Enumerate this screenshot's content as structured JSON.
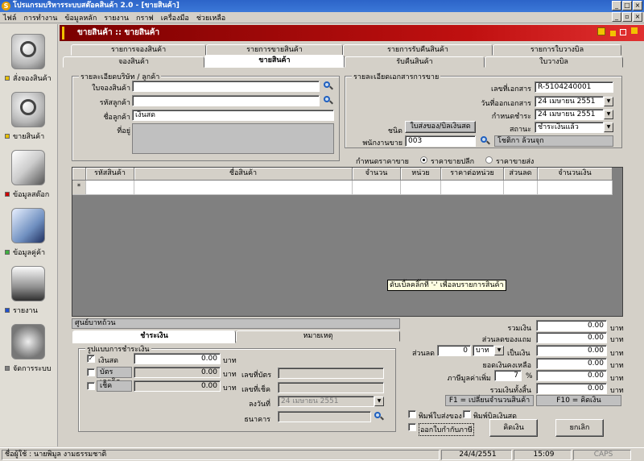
{
  "window": {
    "title": "โปรแกรมบริหารระบบสต๊อคสินค้า 2.0   - [ขายสินค้า]",
    "app_icon": "S"
  },
  "menu": [
    "ไฟล์",
    "การทำงาน",
    "ข้อมูลหลัก",
    "รายงาน",
    "กราฟ",
    "เครื่องมือ",
    "ช่วยเหลือ"
  ],
  "sidebar": [
    {
      "label": "สั่งจองสินค้า",
      "icon": "search-icon",
      "color": "#e8c000"
    },
    {
      "label": "ขายสินค้า",
      "icon": "search-icon",
      "color": "#e8c000"
    },
    {
      "label": "ข้อมูลสต๊อก",
      "icon": "documents-icon",
      "color": "#d00000"
    },
    {
      "label": "ข้อมูลคู่ค้า",
      "icon": "contacts-icon",
      "color": "#40b040"
    },
    {
      "label": "รายงาน",
      "icon": "printer-icon",
      "color": "#2050d0"
    },
    {
      "label": "จัดการระบบ",
      "icon": "gears-icon",
      "color": "#808080"
    }
  ],
  "form_header": {
    "title": "ขายสินค้า :: ขายสินค้า"
  },
  "tabs_top": [
    "รายการจองสินค้า",
    "รายการขายสินค้า",
    "รายการรับคืนสินค้า",
    "รายการใบวางบิล"
  ],
  "tabs_bottom": [
    "จองสินค้า",
    "ขายสินค้า",
    "รับคืนสินค้า",
    "ใบวางบิล"
  ],
  "customer": {
    "group_title": "รายละเอียดบริษัท / ลูกค้า",
    "booking_no_label": "ใบจองสินค้า",
    "booking_no": "",
    "customer_code_label": "รหัสลูกค้า",
    "customer_code": "",
    "customer_name_label": "ชื่อลูกค้า",
    "customer_name": "เงินสด",
    "address_label": "ที่อยู่",
    "address": ""
  },
  "document": {
    "group_title": "รายละเอียดเอกสารการขาย",
    "doc_no_label": "เลขที่เอกสาร",
    "doc_no": "R-5104240001",
    "issue_date_label": "วันที่ออกเอกสาร",
    "issue_date": "24   เมษายน   2551",
    "due_date_label": "กำหนดชำระ",
    "due_date": "24   เมษายน   2551",
    "status_label": "สถานะ",
    "status": "ชำระเงินแล้ว",
    "type_label": "ชนิด",
    "type_button": "ใบส่งของ/บิลเงินสด",
    "salesperson_label": "พนักงานขาย",
    "salesperson_code": "003",
    "salesperson_name": "โชติกา ล้วนจุก"
  },
  "pricing": {
    "label": "กำหนดราคาขาย",
    "retail": "ราคาขายปลีก",
    "wholesale": "ราคาขายส่ง"
  },
  "grid": {
    "columns": [
      "รหัสสินค้า",
      "ชื่อสินค้า",
      "จำนวน",
      "หน่วย",
      "ราคาต่อหน่วย",
      "ส่วนลด",
      "จำนวนเงิน"
    ],
    "new_row_marker": "*",
    "hint": "ดับเบิ้ลคลิ๊กที่ '-' เพื่อลบรายการสินค้า"
  },
  "amount_text": "ศูนย์บาทถ้วน",
  "payment": {
    "tabs": [
      "ชำระเงิน",
      "หมายเหตุ"
    ],
    "group_title": "รูปแบบการชำระเงิน",
    "cash_label": "เงินสด",
    "cash_amount": "0.00",
    "cash_checked": "✓",
    "card_label": "บัตรเครดิต",
    "card_amount": "0.00",
    "cheque_label": "เช็ค",
    "cheque_amount": "0.00",
    "currency": "บาท",
    "card_no_label": "เลขที่บัตร",
    "cheque_no_label": "เลขที่เช็ค",
    "cheque_date_label": "ลงวันที่",
    "cheque_date": "24   เมษายน   2551",
    "bank_label": "ธนาคาร"
  },
  "totals": {
    "total_label": "รวมเงิน",
    "total": "0.00",
    "discount_label": "ส่วนลดของแถม",
    "discount": "0.00",
    "disc2_label": "ส่วนลด",
    "disc2_value": "0",
    "disc2_unit": "บาท",
    "disc2_as": "เป็นเงิน",
    "disc2_amount": "0.00",
    "after_label": "ยอดเงินคงเหลือ",
    "after": "0.00",
    "vat_label": "ภาษีมูลค่าเพิ่ม",
    "vat_rate": "7",
    "vat_pct": "%",
    "vat": "0.00",
    "grand_label": "รวมเงินทั้งสิ้น",
    "grand": "0.00",
    "currency": "บาท"
  },
  "hints": {
    "f1": "F1 = เปลี่ยนจำนวนสินค้า",
    "f10": "F10 = คิดเงิน"
  },
  "print_options": {
    "delivery": "พิมพ์ใบส่งของ",
    "receipt": "พิมพ์บิลเงินสด",
    "tax": "ออกใบกำกับภาษี"
  },
  "buttons": {
    "calc": "คิดเงิน",
    "cancel": "ยกเลิก"
  },
  "status": {
    "user": "ชื่อผู้ใช้ : นายพิมูล งามธรรมชาติ",
    "date": "24/4/2551",
    "time": "15:09",
    "caps": "CAPS"
  }
}
